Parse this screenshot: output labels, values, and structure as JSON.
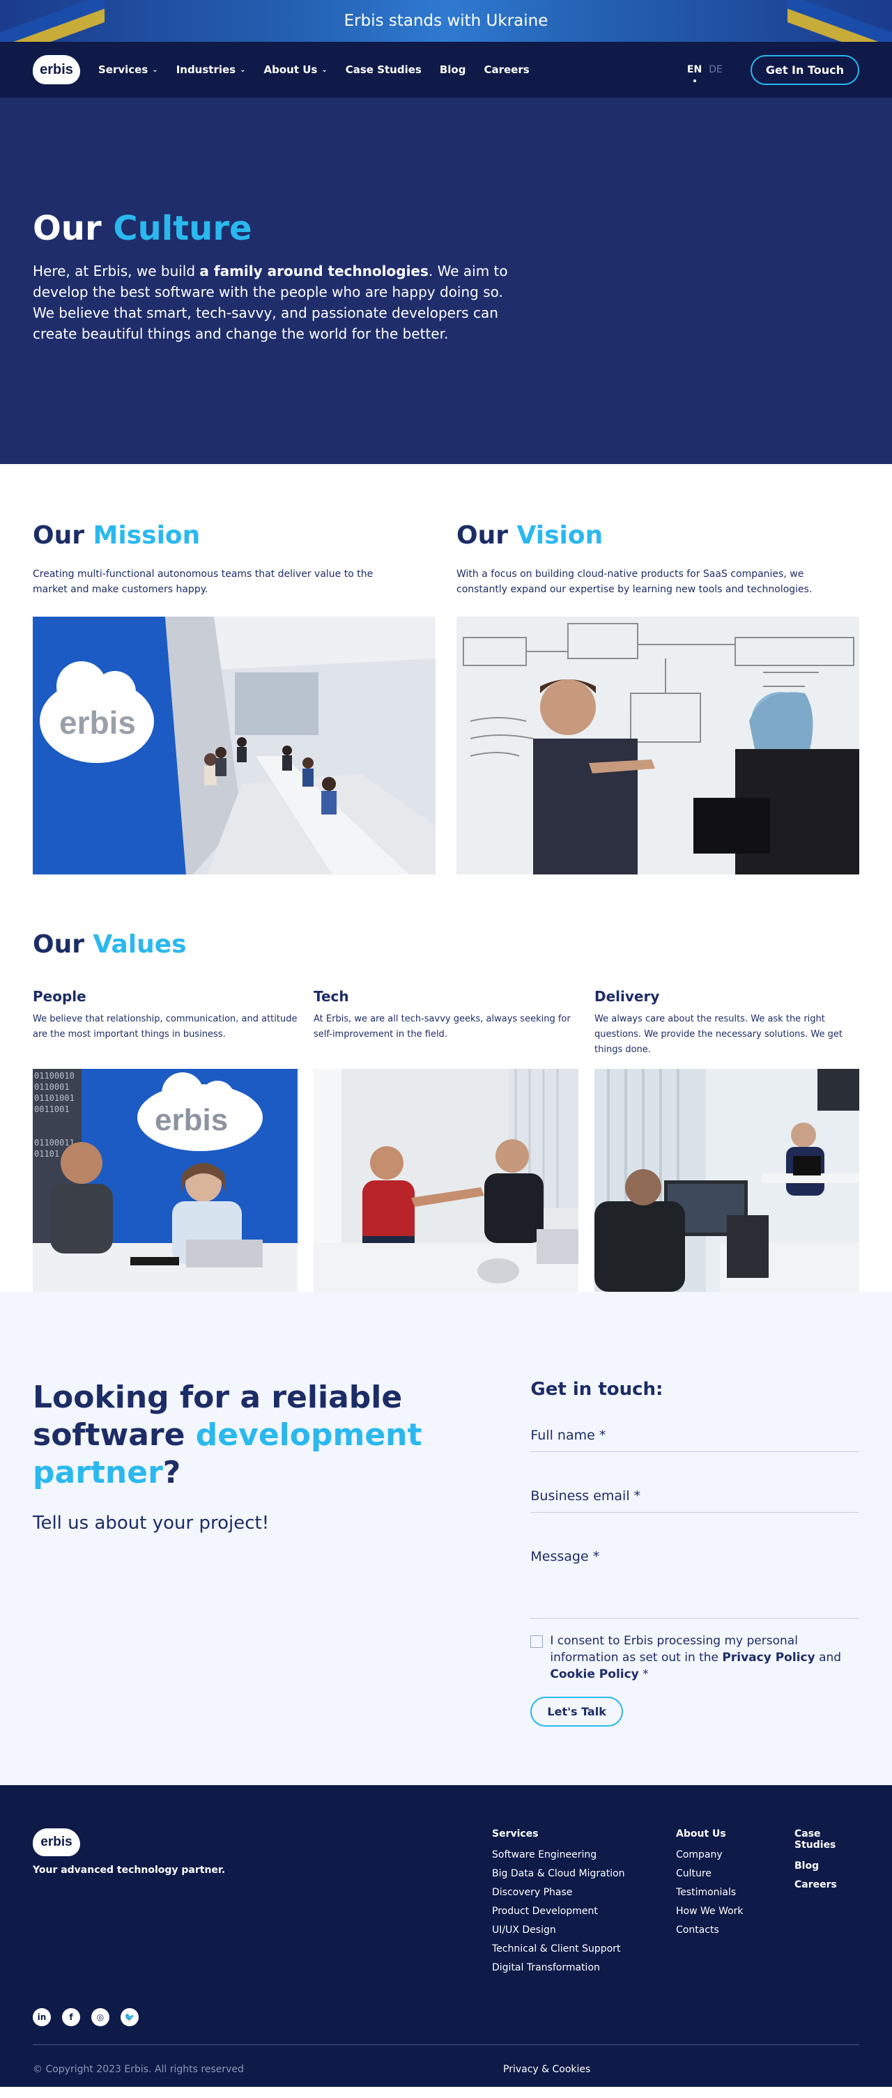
{
  "banner": {
    "text": "Erbis stands with Ukraine"
  },
  "nav": {
    "logo": "erbis",
    "items": [
      {
        "label": "Services",
        "has_dropdown": true
      },
      {
        "label": "Industries",
        "has_dropdown": true
      },
      {
        "label": "About Us",
        "has_dropdown": true
      },
      {
        "label": "Case Studies",
        "has_dropdown": false
      },
      {
        "label": "Blog",
        "has_dropdown": false
      },
      {
        "label": "Careers",
        "has_dropdown": false
      }
    ],
    "lang_active": "EN",
    "lang_other": "DE",
    "cta": "Get In Touch"
  },
  "hero": {
    "title_plain": "Our",
    "title_accent": "Culture",
    "text_before": "Here, at Erbis, we build ",
    "text_bold": "a family around technologies",
    "text_after": ". We aim to develop the best software with the people who are happy doing so. We believe that smart, tech-savvy, and passionate developers can create beautiful things and change the world for the better."
  },
  "mission": {
    "title_plain": "Our",
    "title_accent": "Mission",
    "text": "Creating multi-functional autonomous teams that deliver value to the market and make customers happy.",
    "image_logo": "erbis"
  },
  "vision": {
    "title_plain": "Our",
    "title_accent": "Vision",
    "text": "With a focus on building cloud-native products for SaaS companies, we constantly expand our expertise by learning new tools and technologies."
  },
  "values": {
    "title_plain": "Our",
    "title_accent": "Values",
    "items": [
      {
        "title": "People",
        "text": "We believe that relationship, communication, and attitude are the most important things in business."
      },
      {
        "title": "Tech",
        "text": "At Erbis, we are all tech-savvy geeks, always seeking for self-improvement in the field."
      },
      {
        "title": "Delivery",
        "text": "We always care about the results. We ask the right questions. We provide the necessary solutions. We get things done."
      }
    ],
    "people_image_logo": "erbis"
  },
  "contact": {
    "h_line1": "Looking for a reliable",
    "h_line2": "software ",
    "h_accent": "development partner",
    "h_q": "?",
    "subtitle": "Tell us about your project!",
    "form_title": "Get in touch:",
    "full_name": "Full name *",
    "email": "Business email *",
    "message": "Message *",
    "consent_before": "I consent to Erbis processing my personal information as set out in the ",
    "privacy_policy": "Privacy Policy",
    "and": " and ",
    "cookie_policy": "Cookie Policy",
    "star": " *",
    "submit": "Let's Talk"
  },
  "footer": {
    "logo": "erbis",
    "tagline": "Your advanced technology partner.",
    "services_head": "Services",
    "services": [
      "Software Engineering",
      "Big Data & Cloud Migration",
      "Discovery Phase",
      "Product Development",
      "UI/UX Design",
      "Technical & Client Support",
      "Digital Transformation"
    ],
    "about_head": "About Us",
    "about": [
      "Company",
      "Culture",
      "Testimonials",
      "How We Work",
      "Contacts"
    ],
    "extra_head": "Case Studies",
    "extra": [
      "Blog",
      "Careers"
    ],
    "socials": [
      {
        "icon": "linkedin-icon",
        "glyph": "in"
      },
      {
        "icon": "facebook-icon",
        "glyph": "f"
      },
      {
        "icon": "instagram-icon",
        "glyph": "◎"
      },
      {
        "icon": "twitter-icon",
        "glyph": "🐦"
      }
    ],
    "copyright": "© Copyright 2023 Erbis. All rights reserved",
    "privacy": "Privacy & Cookies"
  },
  "colors": {
    "navy": "#0f1a48",
    "hero_bg": "#1f2d6b",
    "accent": "#2ab8ef",
    "text": "#1c2c66",
    "contact_bg": "#f3f6fd"
  }
}
